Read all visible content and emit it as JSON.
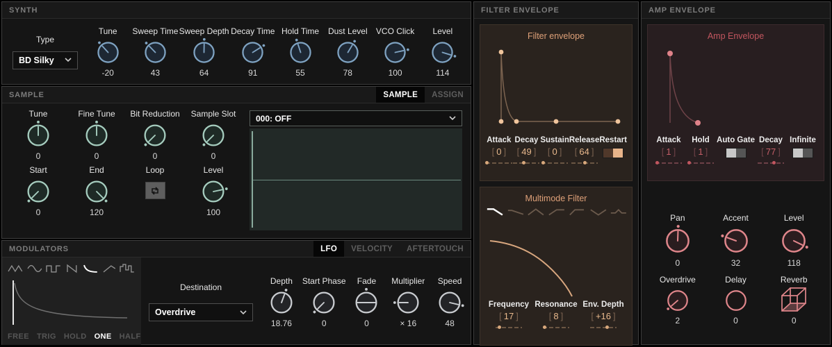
{
  "synth": {
    "header": "SYNTH",
    "type_label": "Type",
    "type_value": "BD Silky",
    "knobs": [
      {
        "label": "Tune",
        "value": "-20",
        "angle": -42
      },
      {
        "label": "Sweep Time",
        "value": "43",
        "angle": -44
      },
      {
        "label": "Sweep Depth",
        "value": "64",
        "angle": 1
      },
      {
        "label": "Decay Time",
        "value": "91",
        "angle": 58
      },
      {
        "label": "Hold Time",
        "value": "55",
        "angle": -18
      },
      {
        "label": "Dust Level",
        "value": "78",
        "angle": 31
      },
      {
        "label": "VCO Click",
        "value": "100",
        "angle": 78
      },
      {
        "label": "Level",
        "value": "114",
        "angle": 107
      }
    ]
  },
  "sample": {
    "header": "SAMPLE",
    "tabs": [
      {
        "label": "SAMPLE",
        "active": true
      },
      {
        "label": "ASSIGN",
        "active": false
      }
    ],
    "knobs_row1": [
      {
        "label": "Tune",
        "value": "0",
        "angle": 0
      },
      {
        "label": "Fine Tune",
        "value": "0",
        "angle": 0
      },
      {
        "label": "Bit Reduction",
        "value": "0",
        "angle": -135
      },
      {
        "label": "Sample Slot",
        "value": "0",
        "angle": -135
      }
    ],
    "start_knob": {
      "label": "Start",
      "value": "0",
      "angle": -135
    },
    "end_knob": {
      "label": "End",
      "value": "120",
      "angle": 135
    },
    "loop_label": "Loop",
    "level_knob": {
      "label": "Level",
      "value": "100",
      "angle": 78
    },
    "slot_value": "000: OFF"
  },
  "modulators": {
    "header": "MODULATORS",
    "tabs": [
      {
        "label": "LFO",
        "active": true
      },
      {
        "label": "VELOCITY",
        "active": false
      },
      {
        "label": "AFTERTOUCH",
        "active": false
      }
    ],
    "modes": [
      {
        "label": "FREE",
        "active": false
      },
      {
        "label": "TRIG",
        "active": false
      },
      {
        "label": "HOLD",
        "active": false
      },
      {
        "label": "ONE",
        "active": true
      },
      {
        "label": "HALF",
        "active": false
      }
    ],
    "active_waveform": "exp-decay",
    "destination_label": "Destination",
    "destination_value": "Overdrive",
    "knobs": [
      {
        "label": "Depth",
        "value": "18.76",
        "angle": 20
      },
      {
        "label": "Start Phase",
        "value": "0",
        "angle": -135
      },
      {
        "label": "Fade",
        "value": "0"
      },
      {
        "label": "Multiplier",
        "value": "× 16",
        "angle": -90
      },
      {
        "label": "Speed",
        "value": "48",
        "angle": 103
      }
    ]
  },
  "filter_env": {
    "header": "FILTER ENVELOPE",
    "title": "Filter envelope",
    "params": [
      {
        "label": "Attack",
        "value": "0",
        "pct": 4
      },
      {
        "label": "Decay",
        "value": "49",
        "pct": 38
      },
      {
        "label": "Sustain",
        "value": "0",
        "pct": 4
      },
      {
        "label": "Release",
        "value": "64",
        "pct": 50
      }
    ],
    "restart": {
      "label": "Restart",
      "on": true
    }
  },
  "filter": {
    "title": "Multimode Filter",
    "active_type": "lowpass-2",
    "params": [
      {
        "label": "Frequency",
        "value": "17",
        "pct": 13
      },
      {
        "label": "Resonance",
        "value": "8",
        "pct": 6
      },
      {
        "label": "Env. Depth",
        "value": "+16",
        "pct": 62
      }
    ]
  },
  "amp_env": {
    "header": "AMP ENVELOPE",
    "title": "Amp Envelope",
    "attack": {
      "label": "Attack",
      "value": "1",
      "pct": 4
    },
    "hold": {
      "label": "Hold",
      "value": "1",
      "pct": 4
    },
    "auto_gate": {
      "label": "Auto Gate",
      "on": false
    },
    "decay": {
      "label": "Decay",
      "value": "77",
      "pct": 60
    },
    "infinite": {
      "label": "Infinite",
      "on": false
    }
  },
  "amp": {
    "pan": {
      "label": "Pan",
      "value": "0",
      "angle": 2
    },
    "accent": {
      "label": "Accent",
      "value": "32",
      "angle": -70
    },
    "level": {
      "label": "Level",
      "value": "118",
      "angle": 116
    },
    "overdrive": {
      "label": "Overdrive",
      "value": "2",
      "angle": -131
    },
    "delay": {
      "label": "Delay",
      "value": "0"
    },
    "reverb": {
      "label": "Reverb",
      "value": "0"
    }
  },
  "colors": {
    "synth_accent": "#7fa3c2",
    "sample_accent": "#a6cdbf",
    "mod_accent": "#c9ccd0",
    "filter_accent": "#e0a87c",
    "amp_accent": "#c2565f",
    "pink_accent": "#e0868b"
  }
}
